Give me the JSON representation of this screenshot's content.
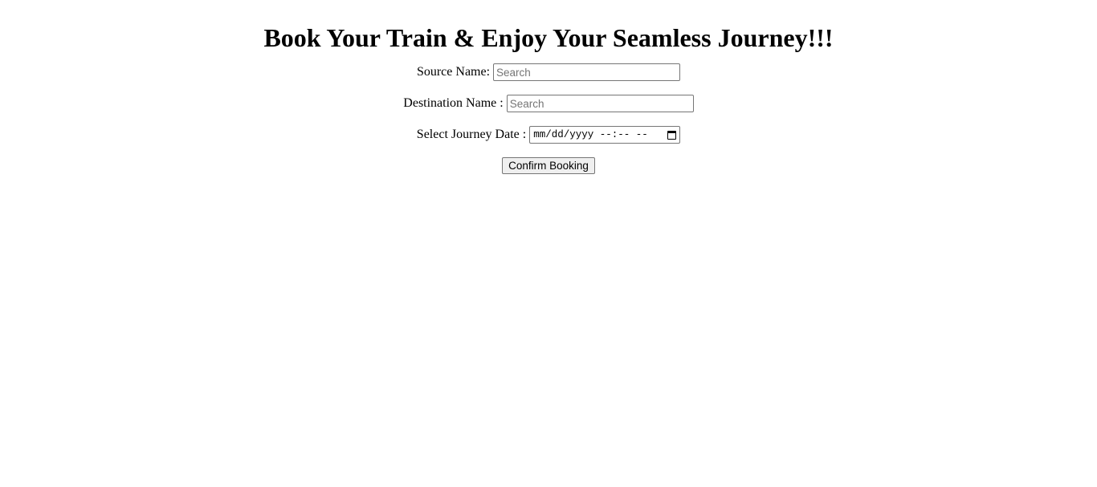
{
  "page": {
    "title": "Book Your Train & Enjoy Your Seamless Journey!!!"
  },
  "form": {
    "source": {
      "label": "Source Name:",
      "value": "",
      "placeholder": "Search"
    },
    "destination": {
      "label": "Destination Name :",
      "value": "",
      "placeholder": "Search"
    },
    "journey_date": {
      "label": "Select Journey Date :",
      "placeholder_display": "mm/dd/yyyy --:-- --",
      "icon": "calendar-icon"
    },
    "confirm_button": {
      "label": "Confirm Booking"
    }
  }
}
